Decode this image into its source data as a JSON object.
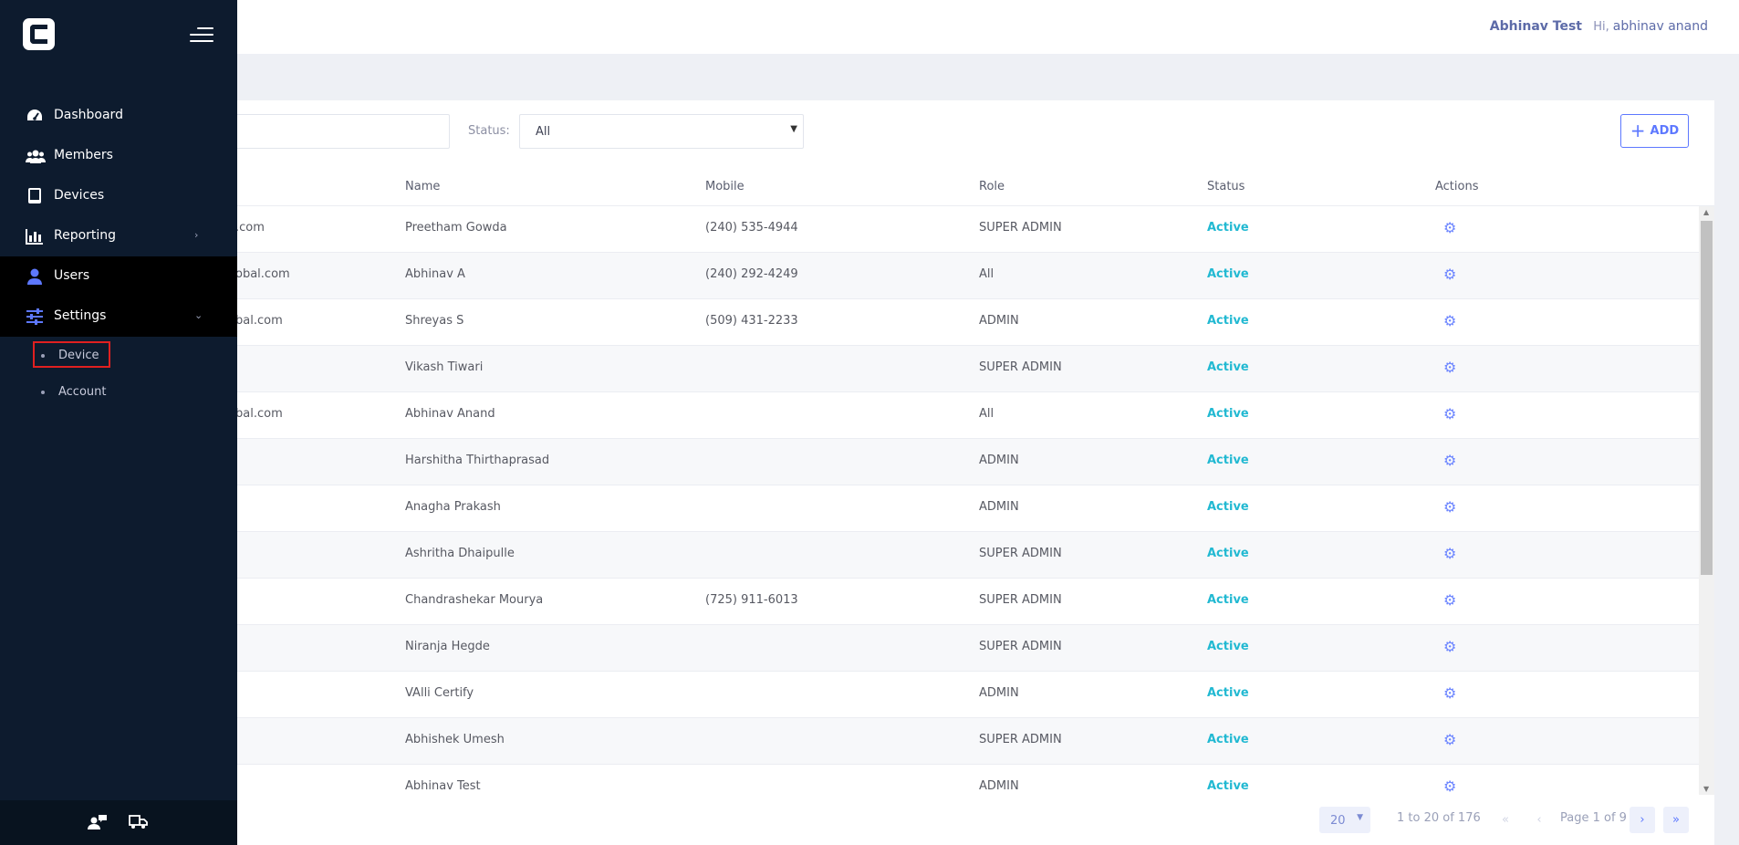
{
  "header": {
    "company": "Abhinav Test",
    "greeting_prefix": "Hi,",
    "user_name": "abhinav anand"
  },
  "sidebar": {
    "logo_letter": "C",
    "items": [
      {
        "label": "Dashboard",
        "icon": "speedometer-icon"
      },
      {
        "label": "Members",
        "icon": "users-group-icon"
      },
      {
        "label": "Devices",
        "icon": "tablet-icon"
      },
      {
        "label": "Reporting",
        "icon": "bar-chart-icon"
      },
      {
        "label": "Users",
        "icon": "user-icon"
      },
      {
        "label": "Settings",
        "icon": "sliders-icon"
      }
    ],
    "settings_sub": [
      {
        "label": "Device"
      },
      {
        "label": "Account"
      }
    ],
    "footer_icons": [
      "user-chat-icon",
      "truck-icon"
    ]
  },
  "filters": {
    "status_label": "Status:",
    "status_value": "All",
    "add_label": "ADD"
  },
  "table": {
    "columns": [
      "Name",
      "Mobile",
      "Role",
      "Status",
      "Actions"
    ],
    "rows": [
      {
        "email": ".com",
        "name": "Preetham Gowda",
        "mobile": "(240) 535-4944",
        "role": "SUPER ADMIN",
        "status": "Active"
      },
      {
        "email": "obal.com",
        "name": "Abhinav A",
        "mobile": "(240) 292-4249",
        "role": "All",
        "status": "Active"
      },
      {
        "email": "bal.com",
        "name": "Shreyas S",
        "mobile": "(509) 431-2233",
        "role": "ADMIN",
        "status": "Active"
      },
      {
        "email": "",
        "name": "Vikash Tiwari",
        "mobile": "",
        "role": "SUPER ADMIN",
        "status": "Active"
      },
      {
        "email": "bal.com",
        "name": "Abhinav Anand",
        "mobile": "",
        "role": "All",
        "status": "Active"
      },
      {
        "email": "",
        "name": "Harshitha Thirthaprasad",
        "mobile": "",
        "role": "ADMIN",
        "status": "Active"
      },
      {
        "email": "",
        "name": "Anagha Prakash",
        "mobile": "",
        "role": "ADMIN",
        "status": "Active"
      },
      {
        "email": "",
        "name": "Ashritha Dhaipulle",
        "mobile": "",
        "role": "SUPER ADMIN",
        "status": "Active"
      },
      {
        "email": "",
        "name": "Chandrashekar Mourya",
        "mobile": "(725) 911-6013",
        "role": "SUPER ADMIN",
        "status": "Active"
      },
      {
        "email": "",
        "name": "Niranja Hegde",
        "mobile": "",
        "role": "SUPER ADMIN",
        "status": "Active"
      },
      {
        "email": "",
        "name": "VAlli Certify",
        "mobile": "",
        "role": "ADMIN",
        "status": "Active"
      },
      {
        "email": "",
        "name": "Abhishek Umesh",
        "mobile": "",
        "role": "SUPER ADMIN",
        "status": "Active"
      },
      {
        "email": "",
        "name": "Abhinav Test",
        "mobile": "",
        "role": "ADMIN",
        "status": "Active"
      }
    ]
  },
  "pagination": {
    "page_size": "20",
    "range": "1 to 20 of 176",
    "page_label": "Page 1 of 9"
  },
  "colors": {
    "sidebar_bg": "#0d1b2e",
    "accent": "#5d78ff",
    "status_active": "#22b9d2",
    "highlight_box": "#e02020"
  }
}
